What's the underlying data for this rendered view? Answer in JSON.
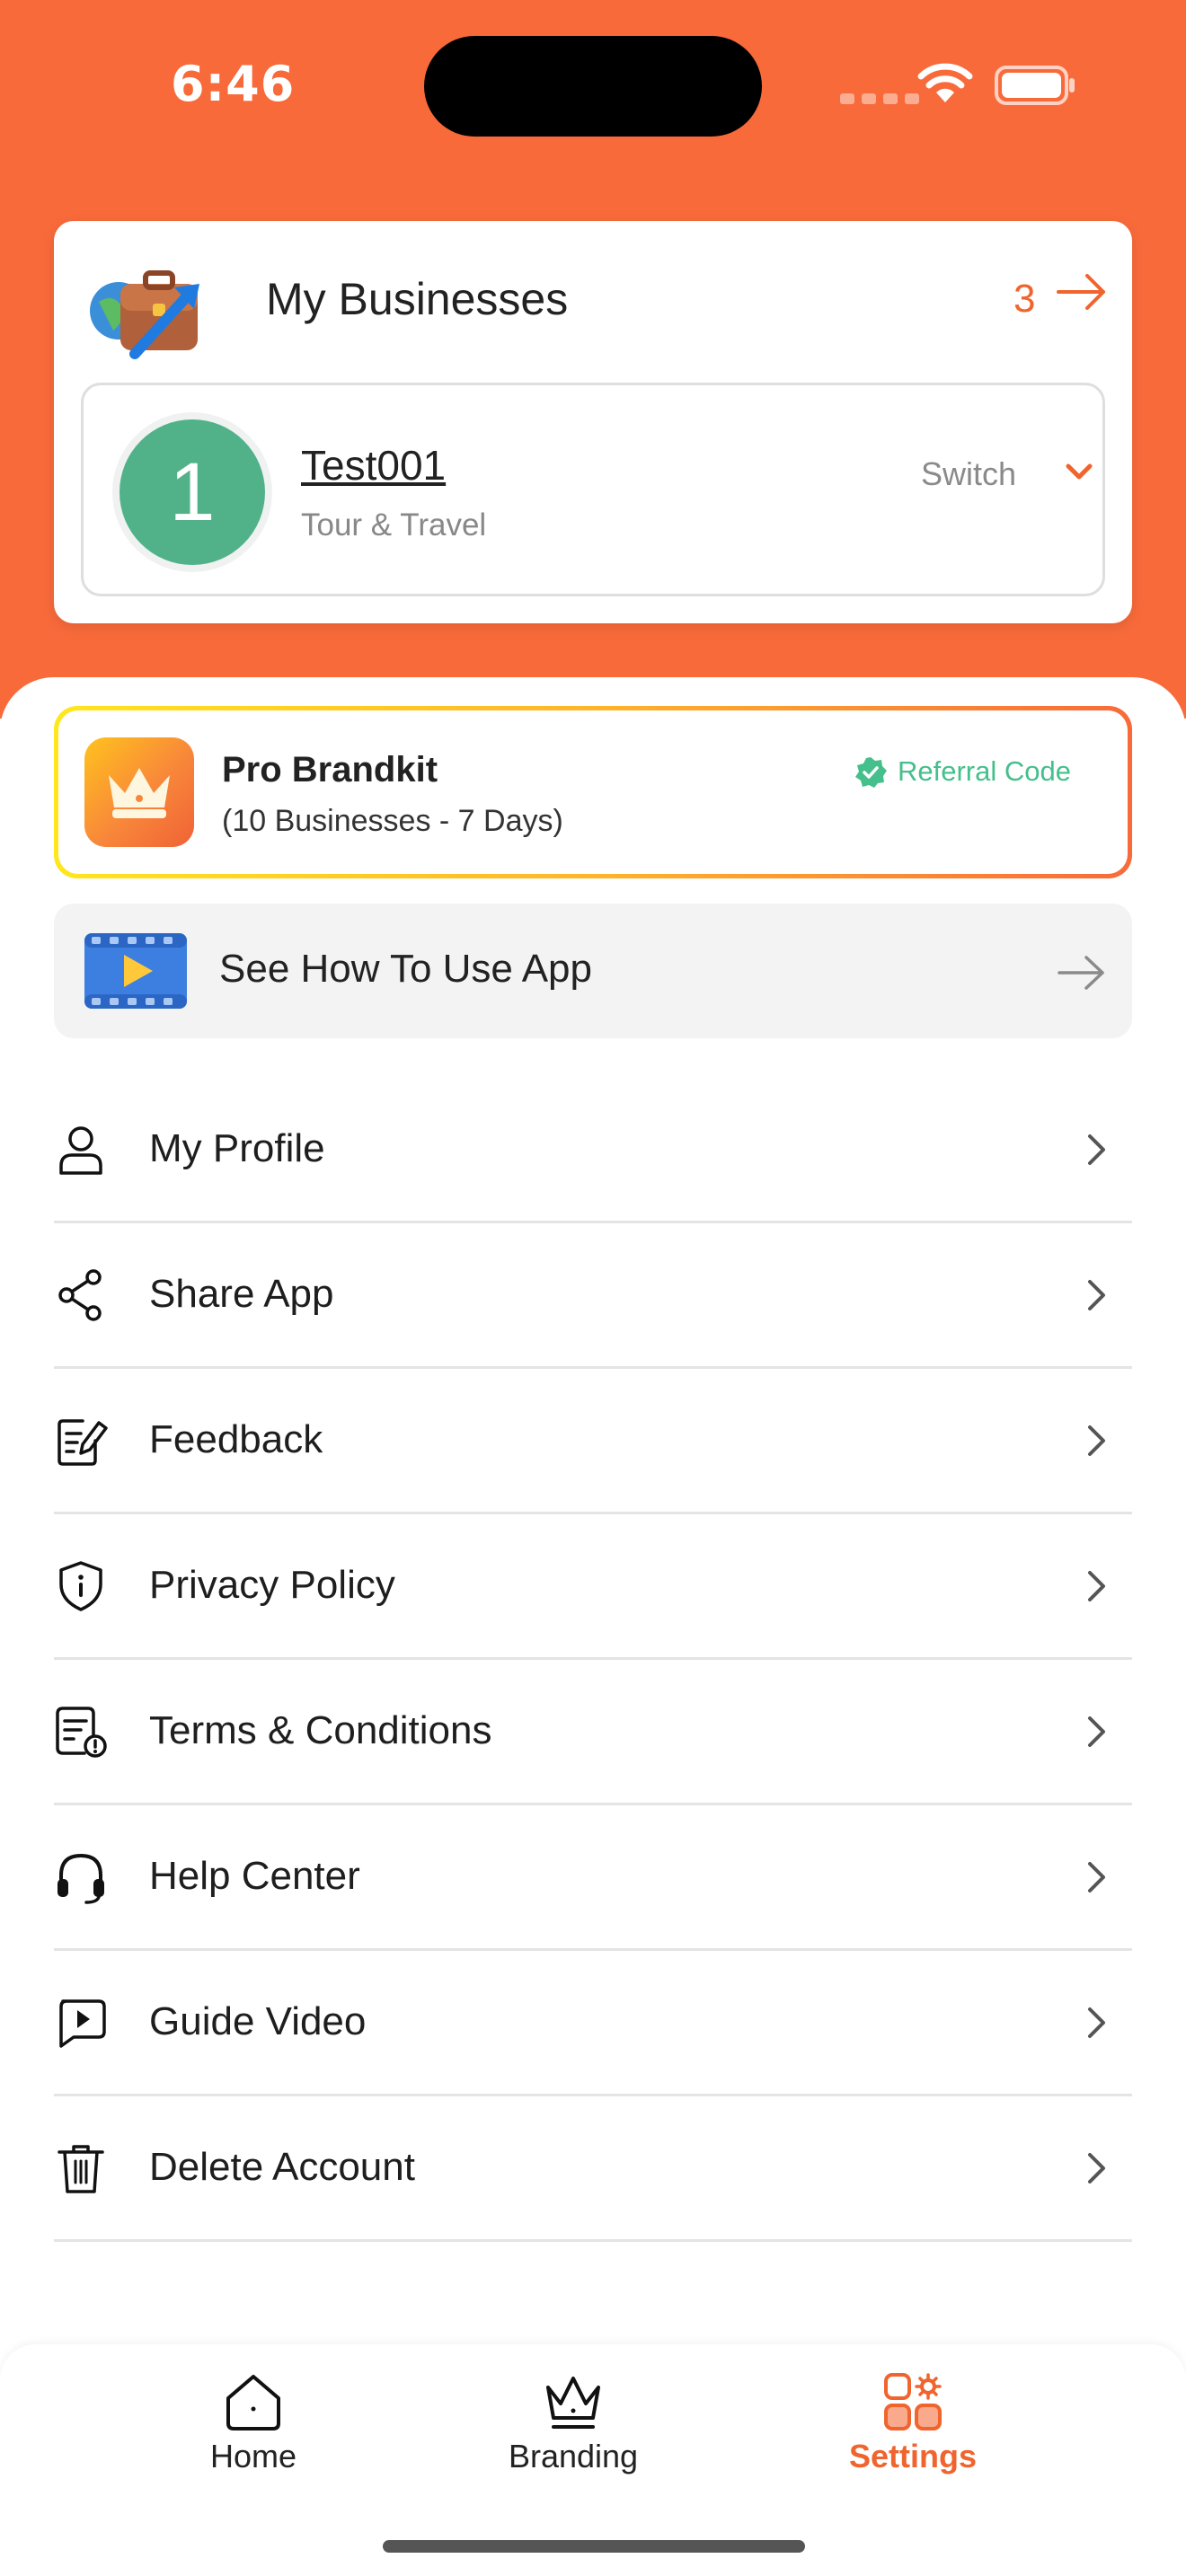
{
  "status_bar": {
    "time": "6:46"
  },
  "businesses": {
    "title": "My Businesses",
    "count": "3",
    "current": {
      "avatar_letter": "1",
      "name": "Test001",
      "category": "Tour & Travel",
      "switch_label": "Switch"
    }
  },
  "plan": {
    "title": "Pro Brandkit",
    "subtitle": "(10 Businesses - 7 Days)",
    "referral_label": "Referral Code"
  },
  "howto": {
    "label": "See How To Use App"
  },
  "menu": {
    "items": [
      {
        "label": "My Profile",
        "icon": "user-icon"
      },
      {
        "label": "Share App",
        "icon": "share-icon"
      },
      {
        "label": "Feedback",
        "icon": "feedback-icon"
      },
      {
        "label": "Privacy Policy",
        "icon": "shield-icon"
      },
      {
        "label": "Terms & Conditions",
        "icon": "document-icon"
      },
      {
        "label": "Help Center",
        "icon": "headset-icon"
      },
      {
        "label": "Guide Video",
        "icon": "video-icon"
      },
      {
        "label": "Delete Account",
        "icon": "trash-icon"
      }
    ]
  },
  "nav": {
    "items": [
      {
        "label": "Home",
        "icon": "home-icon"
      },
      {
        "label": "Branding",
        "icon": "crown-icon"
      },
      {
        "label": "Settings",
        "icon": "settings-grid-icon",
        "active": true
      }
    ]
  },
  "colors": {
    "accent": "#F86A3A",
    "avatar": "#51B28A",
    "referral": "#45BF8B"
  }
}
